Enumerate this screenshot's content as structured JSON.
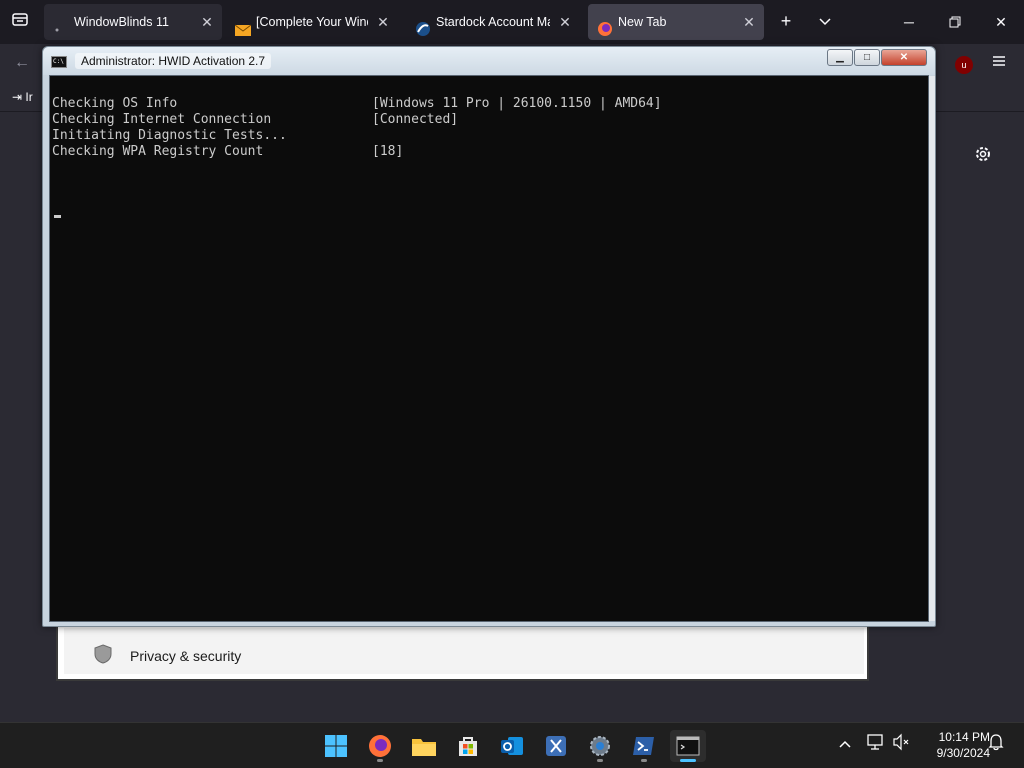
{
  "browser": {
    "tabs": [
      {
        "label": "WindowBlinds 11"
      },
      {
        "label": "[Complete Your Windo"
      },
      {
        "label": "Stardock Account Man"
      },
      {
        "label": "New Tab"
      }
    ],
    "bookmark_label": "Ir",
    "extension_badge": "u"
  },
  "console": {
    "title": "Administrator:  HWID Activation 2.7",
    "lines": [
      {
        "label": "Checking OS Info",
        "value": "[Windows 11 Pro | 26100.1150 | AMD64]"
      },
      {
        "label": "Checking Internet Connection",
        "value": "[Connected]"
      },
      {
        "label": "Initiating Diagnostic Tests...",
        "value": ""
      },
      {
        "label": "Checking WPA Registry Count",
        "value": "[18]"
      }
    ]
  },
  "settings": {
    "item_label": "Privacy & security"
  },
  "taskbar": {
    "apps": [
      "windows-start",
      "firefox",
      "file-explorer",
      "microsoft-store",
      "outlook",
      "snipping-tool",
      "settings",
      "powershell",
      "command-prompt"
    ],
    "clock_time": "10:14 PM",
    "clock_date": "9/30/2024"
  },
  "colors": {
    "console_bg": "#0c0c0c",
    "console_text": "#cccccc",
    "accent": "#4cc2ff"
  }
}
